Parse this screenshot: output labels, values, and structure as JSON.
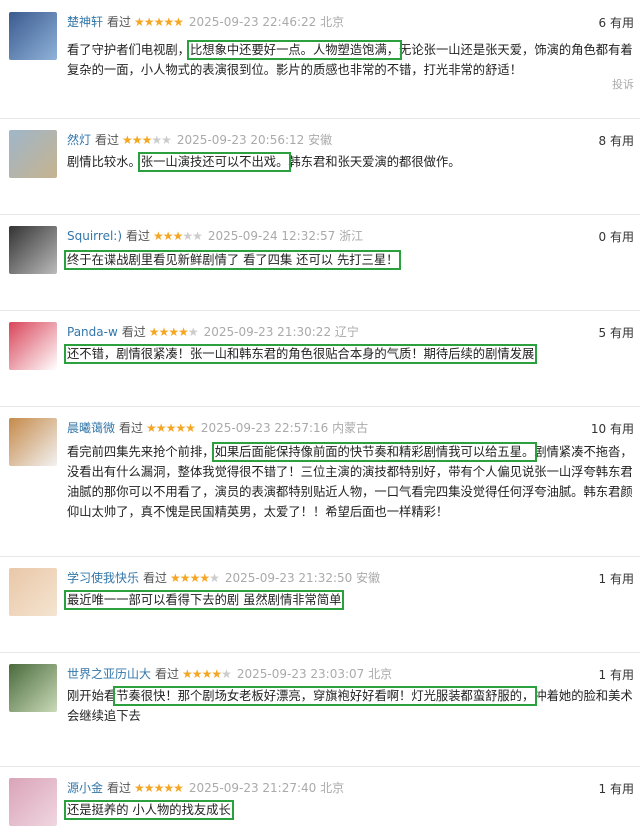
{
  "reviews": [
    {
      "user": "楚神轩",
      "watched": "看过",
      "stars": 5,
      "time": "2025-09-23 22:46:22 北京",
      "useful": "6 有用",
      "pre": "看了守护者们电视剧，",
      "hl": "比想象中还要好一点。人物塑造饱满，",
      "post": "无论张一山还是张天爱，饰演的角色都有着复杂的一面，小人物式的表演很到位。影片的质感也非常的不错，打光非常的舒适！",
      "report": "投诉",
      "colors": [
        "#3b5b8f",
        "#8fb2d9"
      ]
    },
    {
      "user": "然灯",
      "watched": "看过",
      "stars": 3,
      "time": "2025-09-23 20:56:12 安徽",
      "useful": "8 有用",
      "pre": "剧情比较水。",
      "hl": "张一山演技还可以不出戏。",
      "post": "韩东君和张天爱演的都很做作。",
      "colors": [
        "#9fb6c9",
        "#c6b38f"
      ]
    },
    {
      "user": "Squirrel:)",
      "watched": "看过",
      "stars": 3,
      "time": "2025-09-24 12:32:57 浙江",
      "useful": "0 有用",
      "pre": "",
      "hl": "终于在谍战剧里看见新鲜剧情了 看了四集 还可以 先打三星！",
      "post": "",
      "colors": [
        "#333",
        "#bbb"
      ]
    },
    {
      "user": "Panda-w",
      "watched": "看过",
      "stars": 4,
      "time": "2025-09-23 21:30:22 辽宁",
      "useful": "5 有用",
      "pre": "",
      "hl": "还不错，剧情很紧凑！张一山和韩东君的角色很贴合本身的气质！期待后续的剧情发展",
      "post": "",
      "colors": [
        "#d9455a",
        "#fff"
      ]
    },
    {
      "user": "晨曦蔼微",
      "watched": "看过",
      "stars": 5,
      "time": "2025-09-23 22:57:16 内蒙古",
      "useful": "10 有用",
      "pre": "看完前四集先来抢个前排，",
      "hl": "如果后面能保持像前面的快节奏和精彩剧情我可以给五星。",
      "post": "剧情紧凑不拖沓，没看出有什么漏洞，整体我觉得很不错了！三位主演的演技都特别好，带有个人偏见说张一山浮夸韩东君油腻的那你可以不用看了，演员的表演都特别贴近人物，一口气看完四集没觉得任何浮夸油腻。韩东君颜仰山太帅了，真不愧是民国精英男，太爱了！！希望后面也一样精彩！",
      "colors": [
        "#c58a4a",
        "#f2f2f2"
      ]
    },
    {
      "user": "学习使我快乐",
      "watched": "看过",
      "stars": 4,
      "time": "2025-09-23 21:32:50 安徽",
      "useful": "1 有用",
      "pre": "",
      "hl": "最近唯一一部可以看得下去的剧 虽然剧情非常简单",
      "post": "",
      "colors": [
        "#e9c7a8",
        "#f4e4d0"
      ]
    },
    {
      "user": "世界之亚历山大",
      "watched": "看过",
      "stars": 4,
      "time": "2025-09-23 23:03:07 北京",
      "useful": "1 有用",
      "pre": "刚开始看",
      "hl": "节奏很快！那个剧场女老板好漂亮，穿旗袍好好看啊！灯光服装都蛮舒服的，",
      "post": "冲着她的脸和美术会继续追下去",
      "colors": [
        "#4a6b3c",
        "#c9d9b8"
      ]
    },
    {
      "user": "源小金",
      "watched": "看过",
      "stars": 5,
      "time": "2025-09-23 21:27:40 北京",
      "useful": "1 有用",
      "pre": "",
      "hl": "还是挺养的 小人物的找友成长",
      "post": "",
      "colors": [
        "#d9a3b8",
        "#f0d6e0"
      ]
    }
  ]
}
